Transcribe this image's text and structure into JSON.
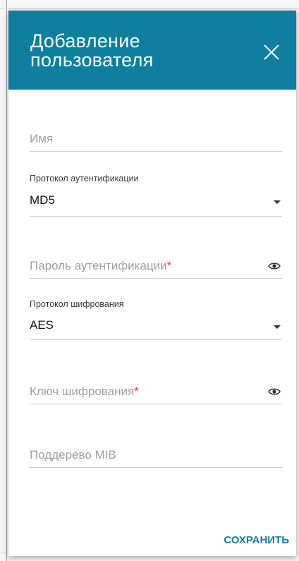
{
  "dialog": {
    "title_line1": "Добавление",
    "title_line2": "пользователя",
    "close_icon": "close-icon"
  },
  "form": {
    "name": {
      "placeholder": "Имя",
      "value": ""
    },
    "auth_protocol": {
      "label": "Протокол аутентификации",
      "value": "MD5"
    },
    "auth_password": {
      "placeholder": "Пароль аутентификации",
      "required_mark": "*",
      "value": "",
      "icon": "eye-icon"
    },
    "priv_protocol": {
      "label": "Протокол шифрования",
      "value": "AES"
    },
    "priv_key": {
      "placeholder": "Ключ шифрования",
      "required_mark": "*",
      "value": "",
      "icon": "eye-icon"
    },
    "mib_subtree": {
      "placeholder": "Поддерево MIB",
      "value": ""
    }
  },
  "actions": {
    "save_label": "СОХРАНИТЬ"
  },
  "colors": {
    "accent": "#0f7fa0",
    "required": "#e53935"
  }
}
